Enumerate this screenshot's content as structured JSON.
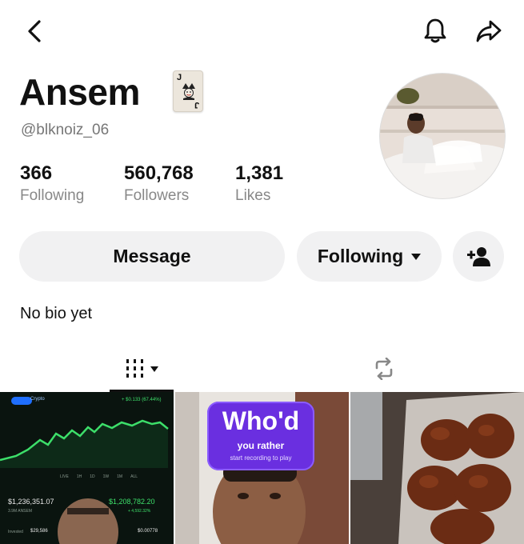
{
  "profile": {
    "display_name": "Ansem",
    "username": "@blknoiz_06",
    "bio": "No bio yet",
    "badge_card": {
      "rank": "J"
    }
  },
  "stats": [
    {
      "value": "366",
      "label": "Following"
    },
    {
      "value": "560,768",
      "label": "Followers"
    },
    {
      "value": "1,381",
      "label": "Likes"
    }
  ],
  "actions": {
    "message_label": "Message",
    "following_label": "Following"
  },
  "thumbnails": {
    "chart": {
      "tag": "Crypto",
      "change": "+ $0.133 (67.44%)",
      "ranges": [
        "LIVE",
        "1H",
        "1D",
        "1W",
        "1M",
        "ALL"
      ],
      "balance": "$1,236,351.07",
      "holding": "3.9M ANSEM",
      "value2": "$1,208,782.20",
      "change2": "+ 4,592.32%",
      "invested_label": "Invested",
      "invested_value": "$29,586",
      "price": "$0.00778"
    },
    "game": {
      "title": "Who'd",
      "line1": "you rather",
      "line2": "start recording to play"
    }
  },
  "colors": {
    "text": "#111111",
    "muted": "#888888",
    "button_bg": "#f1f1f2",
    "chart_green": "#3ee06b"
  },
  "icons": [
    "chevron-left-icon",
    "bell-icon",
    "share-arrow-icon",
    "joker-card-icon",
    "caret-down-icon",
    "add-user-icon",
    "grid-icon",
    "repost-icon"
  ]
}
